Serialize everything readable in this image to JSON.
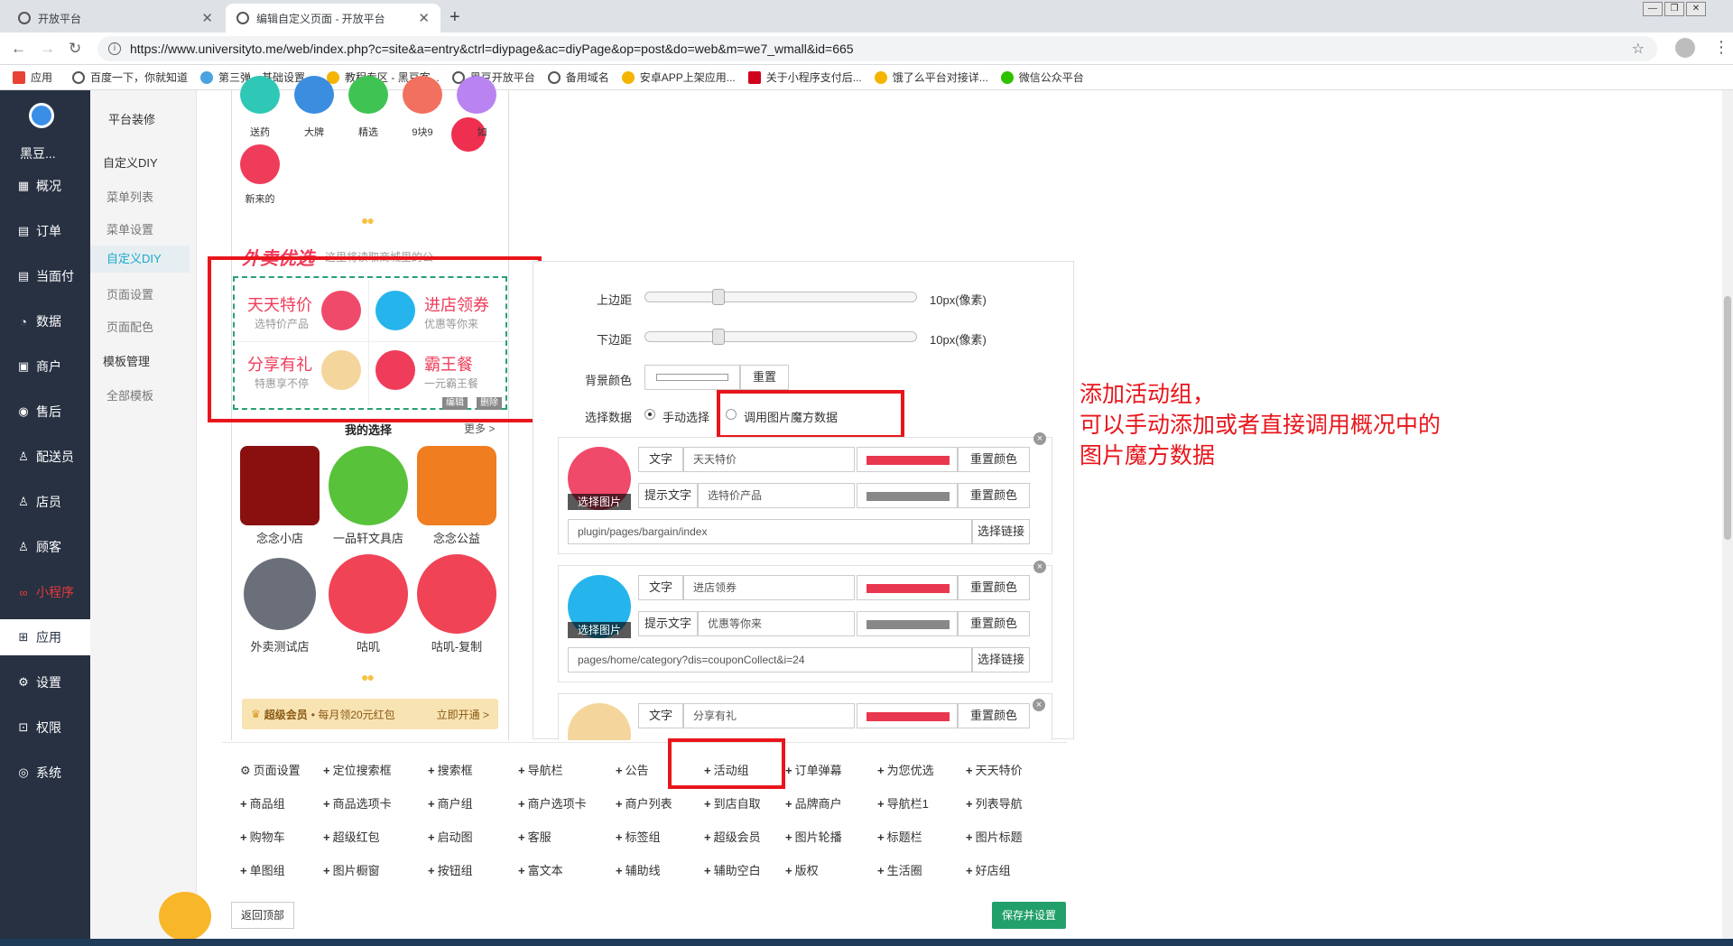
{
  "browser": {
    "tabs": [
      {
        "title": "开放平台"
      },
      {
        "title": "编辑自定义页面 - 开放平台"
      }
    ],
    "url": "https://www.universityto.me/web/index.php?c=site&a=entry&ctrl=diypage&ac=diyPage&op=post&do=web&m=we7_wmall&id=665",
    "bookmarks": [
      "应用",
      "百度一下，你就知道",
      "第三弹、基础设置...",
      "教程专区 - 黑豆客...",
      "黑豆开放平台",
      "备用域名",
      "安卓APP上架应用...",
      "关于小程序支付后...",
      "饿了么平台对接详...",
      "微信公众平台"
    ]
  },
  "sidebar": {
    "brand": "黑豆...",
    "items": [
      {
        "label": "概况",
        "icon": "dashboard-icon"
      },
      {
        "label": "订单",
        "icon": "order-icon"
      },
      {
        "label": "当面付",
        "icon": "pay-icon"
      },
      {
        "label": "数据",
        "icon": "chart-icon"
      },
      {
        "label": "商户",
        "icon": "store-icon"
      },
      {
        "label": "售后",
        "icon": "service-icon"
      },
      {
        "label": "配送员",
        "icon": "courier-icon"
      },
      {
        "label": "店员",
        "icon": "clerk-icon"
      },
      {
        "label": "顾客",
        "icon": "customer-icon"
      },
      {
        "label": "小程序",
        "icon": "miniapp-icon"
      },
      {
        "label": "应用",
        "icon": "apps-icon"
      },
      {
        "label": "设置",
        "icon": "gear-icon"
      },
      {
        "label": "权限",
        "icon": "lock-icon"
      },
      {
        "label": "系统",
        "icon": "system-icon"
      }
    ]
  },
  "submenu": {
    "platform": "平台装修",
    "group1": "自定义DIY",
    "items1": [
      "菜单列表",
      "菜单设置",
      "自定义DIY",
      "页面设置",
      "页面配色"
    ],
    "group2": "模板管理",
    "items2": [
      "全部模板"
    ]
  },
  "preview": {
    "top_icons": [
      "送药",
      "大牌",
      "精选",
      "9块9",
      "如"
    ],
    "new_icon": "新来的",
    "waimai_title": "外卖优选",
    "waimai_hint": "这里将读取商城里的公",
    "activities": [
      {
        "title": "天天特价",
        "sub": "选特价产品"
      },
      {
        "title": "进店领券",
        "sub": "优惠等你来"
      },
      {
        "title": "分享有礼",
        "sub": "特惠享不停"
      },
      {
        "title": "霸王餐",
        "sub": "一元霸王餐"
      }
    ],
    "edit_label": "编辑",
    "delete_label": "删除",
    "my_choice": "我的选择",
    "more": "更多 >",
    "shops": [
      "念念小店",
      "一品轩文具店",
      "念念公益",
      "外卖测试店",
      "咕叽",
      "咕叽-复制"
    ],
    "vip_text": "超级会员",
    "vip_desc": "• 每月领20元红包",
    "vip_action": "立即开通 >"
  },
  "editor": {
    "top_margin_label": "上边距",
    "top_margin_value": "10px(像素)",
    "top_margin_level": 0.2,
    "bottom_margin_label": "下边距",
    "bottom_margin_value": "10px(像素)",
    "bottom_margin_level": 0.2,
    "bg_color_label": "背景颜色",
    "reset": "重置",
    "data_label": "选择数据",
    "manual": "手动选择",
    "magic": "调用图片魔方数据",
    "text_label": "文字",
    "hint_label": "提示文字",
    "reset_color": "重置颜色",
    "pick_image": "选择图片",
    "pick_link": "选择链接",
    "cards": [
      {
        "title": "天天特价",
        "hint": "选特价产品",
        "link": "plugin/pages/bargain/index"
      },
      {
        "title": "进店领券",
        "hint": "优惠等你来",
        "link": "pages/home/category?dis=couponCollect&i=24"
      },
      {
        "title": "分享有礼"
      }
    ],
    "title_color": "#e8374f",
    "hint_color": "#888888"
  },
  "toolbar": {
    "items": [
      "页面设置",
      "定位搜索框",
      "搜索框",
      "导航栏",
      "公告",
      "活动组",
      "订单弹幕",
      "为您优选",
      "天天特价",
      "商品组",
      "商品选项卡",
      "商户组",
      "商户选项卡",
      "商户列表",
      "到店自取",
      "品牌商户",
      "导航栏1",
      "列表导航",
      "购物车",
      "超级红包",
      "启动图",
      "客服",
      "标签组",
      "超级会员",
      "图片轮播",
      "标题栏",
      "图片标题",
      "单图组",
      "图片橱窗",
      "按钮组",
      "富文本",
      "辅助线",
      "辅助空白",
      "版权",
      "生活圈",
      "好店组"
    ],
    "back": "返回顶部",
    "save": "保存并设置"
  },
  "annotation": [
    "添加活动组，",
    "可以手动添加或者直接调用概况中的",
    "图片魔方数据"
  ]
}
